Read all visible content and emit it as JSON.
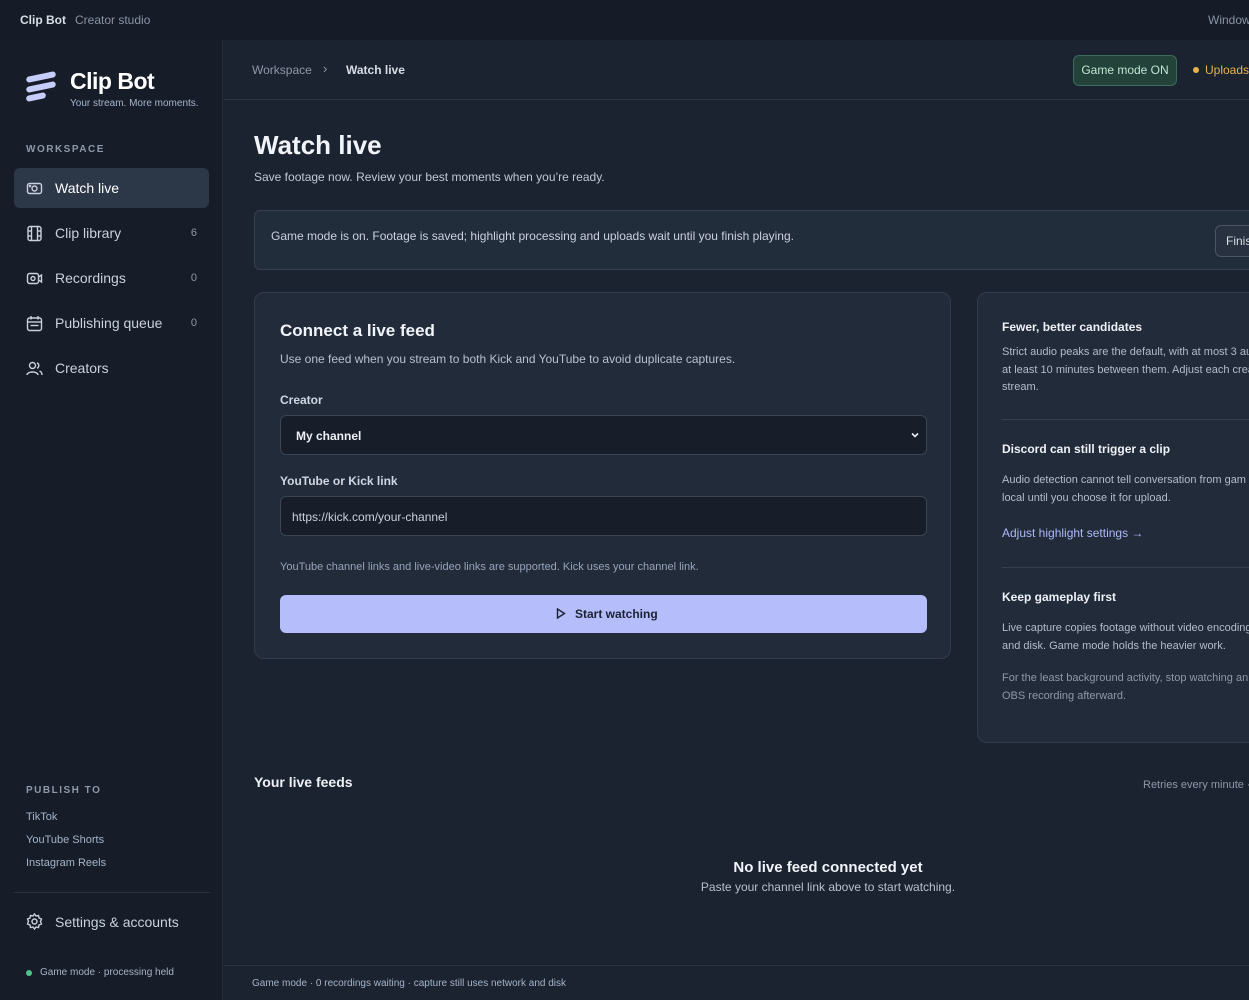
{
  "titlebar": {
    "app": "Clip Bot",
    "subtitle": "Creator studio",
    "window_menu": "Window"
  },
  "sidebar": {
    "brand": "Clip Bot",
    "tagline": "Your stream. More moments.",
    "workspace_label": "WORKSPACE",
    "items": [
      {
        "label": "Watch live",
        "count": "",
        "icon": "camera-icon",
        "active": true
      },
      {
        "label": "Clip library",
        "count": "6",
        "icon": "film-icon"
      },
      {
        "label": "Recordings",
        "count": "0",
        "icon": "video-icon"
      },
      {
        "label": "Publishing queue",
        "count": "0",
        "icon": "calendar-icon"
      },
      {
        "label": "Creators",
        "count": "",
        "icon": "users-icon"
      }
    ],
    "publish_label": "PUBLISH TO",
    "publish_targets": [
      "TikTok",
      "YouTube Shorts",
      "Instagram Reels"
    ],
    "settings_label": "Settings & accounts",
    "status": "Game mode · processing held"
  },
  "header": {
    "breadcrumb": [
      "Workspace",
      "Watch live"
    ],
    "game_mode_badge": "Game mode ON",
    "uploads_status": "Uploads"
  },
  "page": {
    "title": "Watch live",
    "subtitle": "Save footage now. Review your best moments when you’re ready."
  },
  "notice": {
    "text": "Game mode is on. Footage is saved; highlight processing and uploads wait until you finish playing.",
    "button": "Finish"
  },
  "connect": {
    "title": "Connect a live feed",
    "description": "Use one feed when you stream to both Kick and YouTube to avoid duplicate captures.",
    "creator_label": "Creator",
    "creator_value": "My channel",
    "link_label": "YouTube or Kick link",
    "link_placeholder": "https://kick.com/your-channel",
    "hint": "YouTube channel links and live-video links are supported. Kick uses your channel link.",
    "start_button": "Start watching"
  },
  "tips": {
    "t1_title": "Fewer, better candidates",
    "t1_body": "Strict audio peaks are the default, with at most 3 au at least 10 minutes between them. Adjust each crea stream.",
    "t2_title": "Discord can still trigger a clip",
    "t2_body": "Audio detection cannot tell conversation from gam local until you choose it for upload.",
    "t2_link": "Adjust highlight settings →",
    "t3_title": "Keep gameplay first",
    "t3_body": "Live capture copies footage without video encoding and disk. Game mode holds the heavier work.",
    "t3_body2": "For the least background activity, stop watching an OBS recording afterward."
  },
  "feeds": {
    "title": "Your live feeds",
    "retry": "Retries every minute ·",
    "empty_title": "No live feed connected yet",
    "empty_sub": "Paste your channel link above to start watching."
  },
  "footer": {
    "text": "Game mode · 0 recordings waiting · capture still uses network and disk"
  },
  "colors": {
    "accent": "#b5bdfb",
    "game_mode": "#4cc38a",
    "uploads": "#e8b24a",
    "background": "#1b2331"
  }
}
